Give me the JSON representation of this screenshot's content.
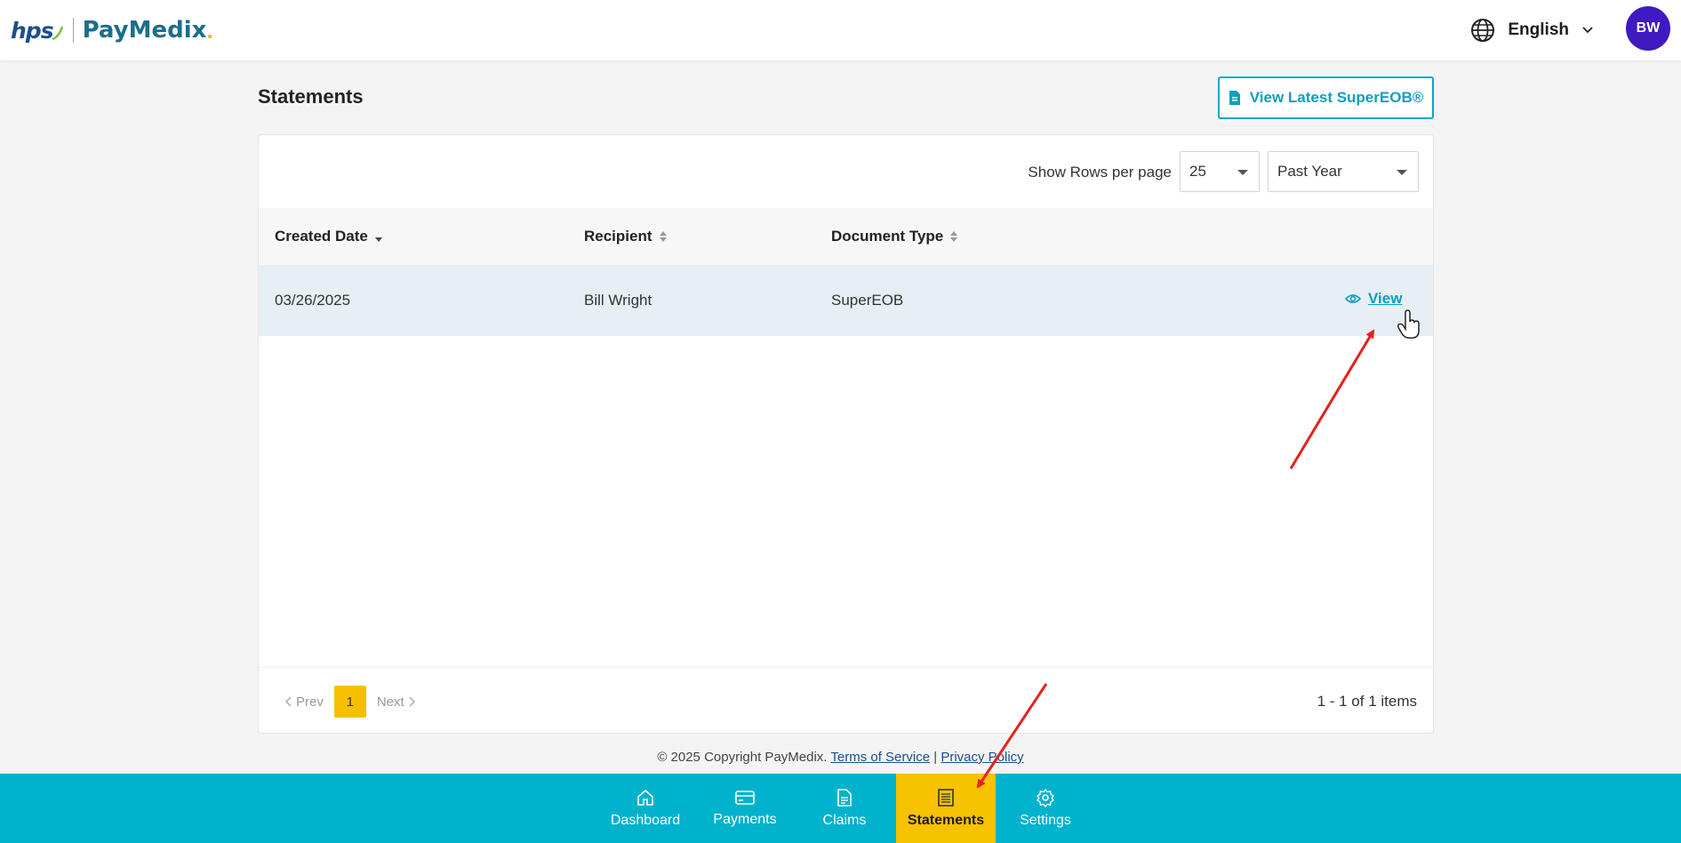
{
  "header": {
    "logo_hps": "hps",
    "logo_brand": "PayMedix",
    "language": "English",
    "avatar_initials": "BW"
  },
  "page": {
    "title": "Statements",
    "latest_button": "View Latest SuperEOB®"
  },
  "controls": {
    "rows_label": "Show Rows per page",
    "rows_value": "25",
    "period_value": "Past Year"
  },
  "table": {
    "columns": [
      "Created Date",
      "Recipient",
      "Document Type"
    ],
    "rows": [
      {
        "date": "03/26/2025",
        "recipient": "Bill Wright",
        "doc_type": "SuperEOB",
        "action": "View"
      }
    ]
  },
  "pagination": {
    "prev": "Prev",
    "current": "1",
    "next": "Next",
    "summary": "1 - 1 of 1 items"
  },
  "footer": {
    "copyright": "© 2025 Copyright PayMedix.",
    "terms": "Terms of Service",
    "sep": "|",
    "privacy": "Privacy Policy"
  },
  "bottom_nav": [
    {
      "label": "Dashboard",
      "icon": "home-icon"
    },
    {
      "label": "Payments",
      "icon": "credit-card-icon"
    },
    {
      "label": "Claims",
      "icon": "document-icon"
    },
    {
      "label": "Statements",
      "icon": "statement-icon",
      "active": true
    },
    {
      "label": "Settings",
      "icon": "gear-icon"
    }
  ],
  "colors": {
    "accent": "#00b2cc",
    "active_nav": "#f7c200",
    "avatar": "#3f1ac0",
    "annotation": "#e8201c"
  }
}
